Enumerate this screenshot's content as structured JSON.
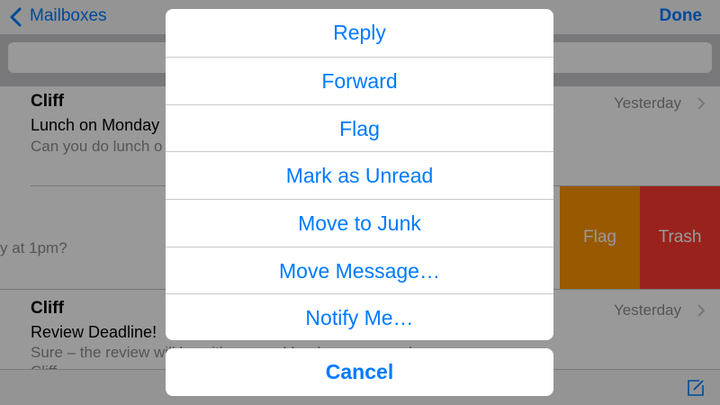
{
  "navbar": {
    "back_label": "Mailboxes",
    "done_label": "Done"
  },
  "messages": [
    {
      "sender": "Cliff",
      "subject": "Lunch on Monday",
      "preview": "Can you do lunch o",
      "date": "Yesterday"
    },
    {
      "preview": "y at 1pm?",
      "actions": {
        "flag": "Flag",
        "trash": "Trash"
      }
    },
    {
      "sender": "Cliff",
      "subject": "Review Deadline!",
      "preview": "Sure – the review will be with you on Monday, as agreed",
      "line4": "Cliff",
      "date": "Yesterday"
    }
  ],
  "action_sheet": {
    "items": [
      "Reply",
      "Forward",
      "Flag",
      "Mark as Unread",
      "Move to Junk",
      "Move Message…",
      "Notify Me…"
    ],
    "cancel": "Cancel"
  },
  "colors": {
    "accent": "#007aff",
    "flag": "#ff9500",
    "trash": "#ff3b30"
  },
  "icons": [
    "chevron-left-icon",
    "chevron-right-icon",
    "compose-icon"
  ]
}
